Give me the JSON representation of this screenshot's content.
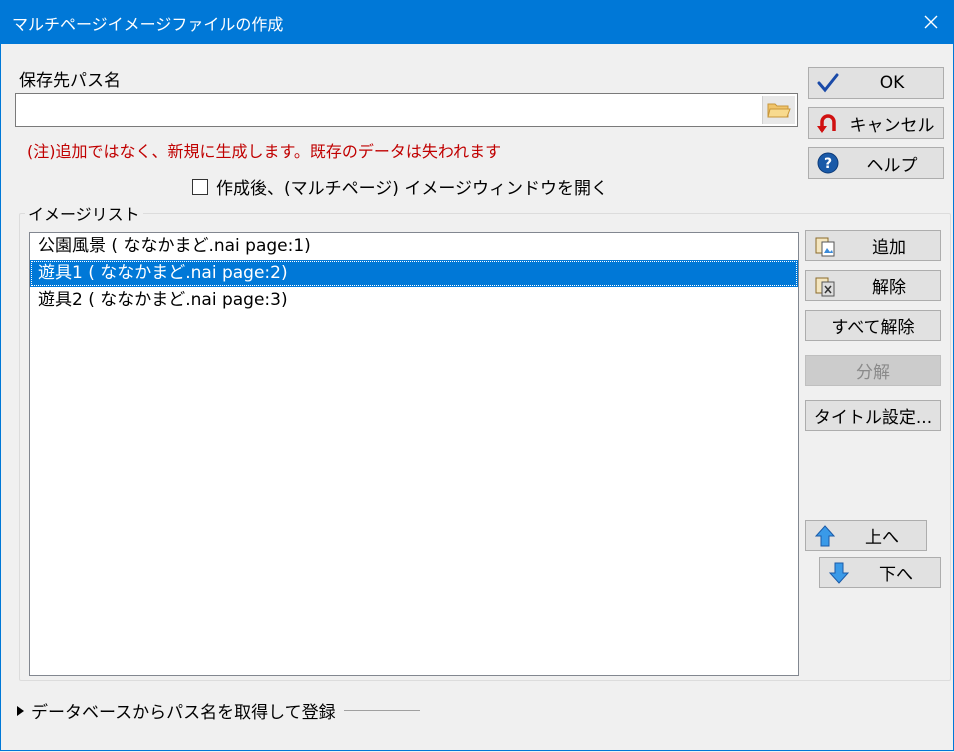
{
  "window": {
    "title": "マルチページイメージファイルの作成"
  },
  "path_label": "保存先パス名",
  "path_input": {
    "value": "",
    "placeholder": ""
  },
  "note": "(注)追加ではなく、新規に生成します。既存のデータは失われます",
  "open_after": {
    "label": "作成後、(マルチページ) イメージウィンドウを開く",
    "checked": false
  },
  "buttons": {
    "ok": "OK",
    "cancel": "キャンセル",
    "help": "ヘルプ"
  },
  "image_list": {
    "legend": "イメージリスト",
    "items": [
      {
        "text": "公園風景 ( ななかまど.nai page:1)",
        "selected": false
      },
      {
        "text": "遊具1 ( ななかまど.nai page:2)",
        "selected": true
      },
      {
        "text": "遊具2 ( ななかまど.nai page:3)",
        "selected": false
      }
    ]
  },
  "side_buttons": {
    "add": "追加",
    "remove": "解除",
    "remove_all": "すべて解除",
    "split": "分解",
    "title_settings": "タイトル設定...",
    "up": "上へ",
    "down": "下へ"
  },
  "footer": {
    "label": "データベースからパス名を取得して登録"
  },
  "colors": {
    "accent": "#0078d7",
    "note_red": "#c00000"
  }
}
